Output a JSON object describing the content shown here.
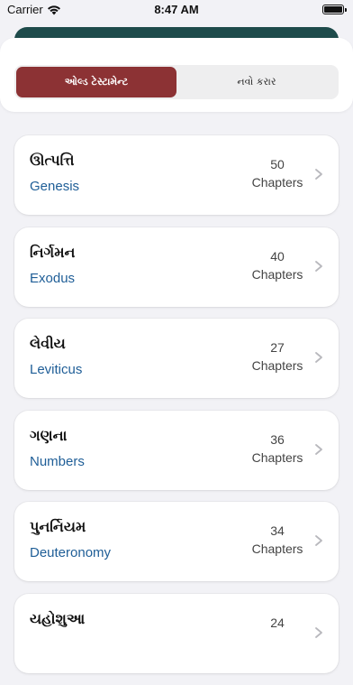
{
  "status_bar": {
    "carrier": "Carrier",
    "time": "8:47 AM"
  },
  "tabs": [
    {
      "label": "ઓલ્ડ ટેસ્ટામેન્ટ",
      "active": true
    },
    {
      "label": "નવો કરાર",
      "active": false
    }
  ],
  "books": [
    {
      "name_gu": "ઊત્પત્તિ",
      "name_en": "Genesis",
      "chapters": "50",
      "chapters_label": "Chapters"
    },
    {
      "name_gu": "નિર્ગમન",
      "name_en": "Exodus",
      "chapters": "40",
      "chapters_label": "Chapters"
    },
    {
      "name_gu": "લેવીય",
      "name_en": "Leviticus",
      "chapters": "27",
      "chapters_label": "Chapters"
    },
    {
      "name_gu": "ગણના",
      "name_en": "Numbers",
      "chapters": "36",
      "chapters_label": "Chapters"
    },
    {
      "name_gu": "પુનર્નિયમ",
      "name_en": "Deuteronomy",
      "chapters": "34",
      "chapters_label": "Chapters"
    },
    {
      "name_gu": "યહોશુઆ",
      "name_en": "",
      "chapters": "24",
      "chapters_label": ""
    }
  ],
  "colors": {
    "active_tab": "#8c3234",
    "english_name": "#1f5e97",
    "header_strip": "#1e4b4b",
    "background": "#f2f2f6"
  },
  "icons": {
    "wifi": "wifi-icon",
    "battery": "battery-icon",
    "chevron": "chevron-right-icon"
  }
}
